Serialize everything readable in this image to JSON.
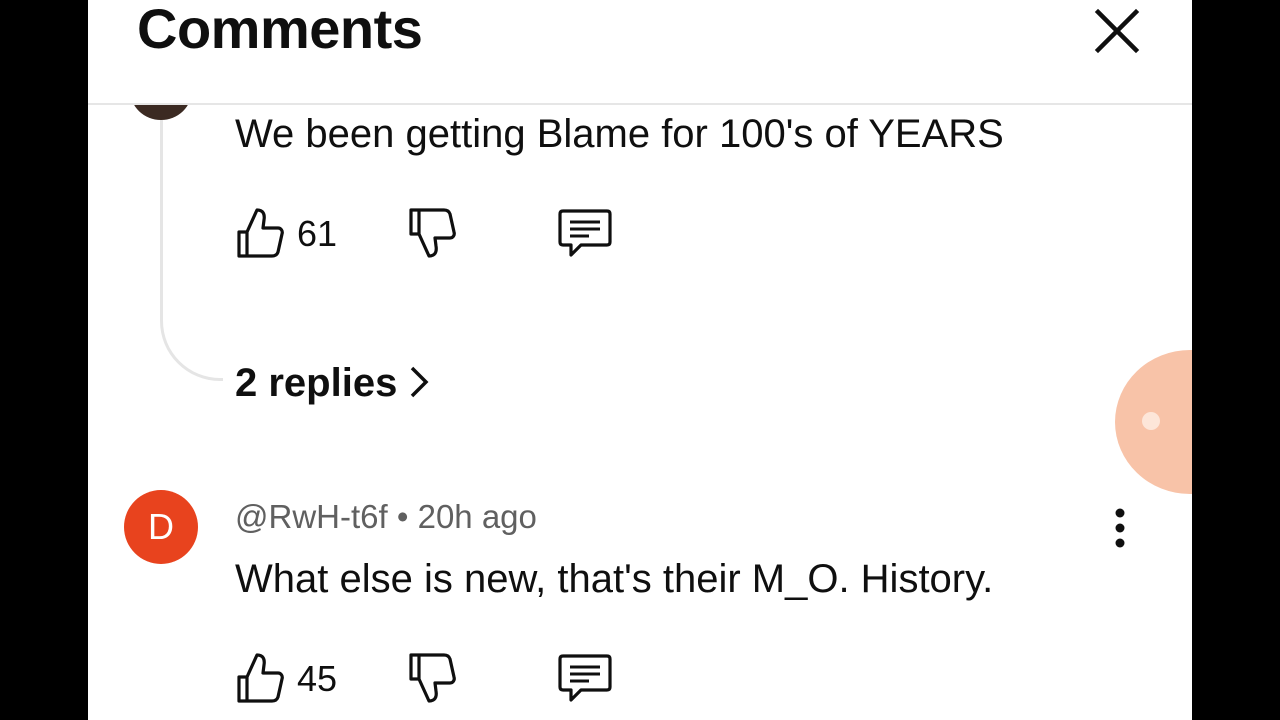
{
  "header": {
    "title": "Comments",
    "close_icon": "close-icon"
  },
  "comments": [
    {
      "text": "We been getting Blame for 100's of YEARS",
      "like_count": "61",
      "replies_label": "2 replies",
      "icons": [
        "thumbs-up-icon",
        "thumbs-down-icon",
        "reply-icon"
      ]
    },
    {
      "avatar_letter": "D",
      "avatar_color": "#e8431e",
      "author": "@RwH-t6f",
      "separator": "•",
      "time": "20h ago",
      "text": "What else is new, that's their M_O. History.",
      "like_count": "45",
      "icons": [
        "thumbs-up-icon",
        "thumbs-down-icon",
        "reply-icon",
        "more-vert-icon"
      ]
    }
  ],
  "colors": {
    "background": "#ffffff",
    "text": "#0f0f0f",
    "meta_text": "#606060",
    "fab": "#f8c3a8"
  }
}
